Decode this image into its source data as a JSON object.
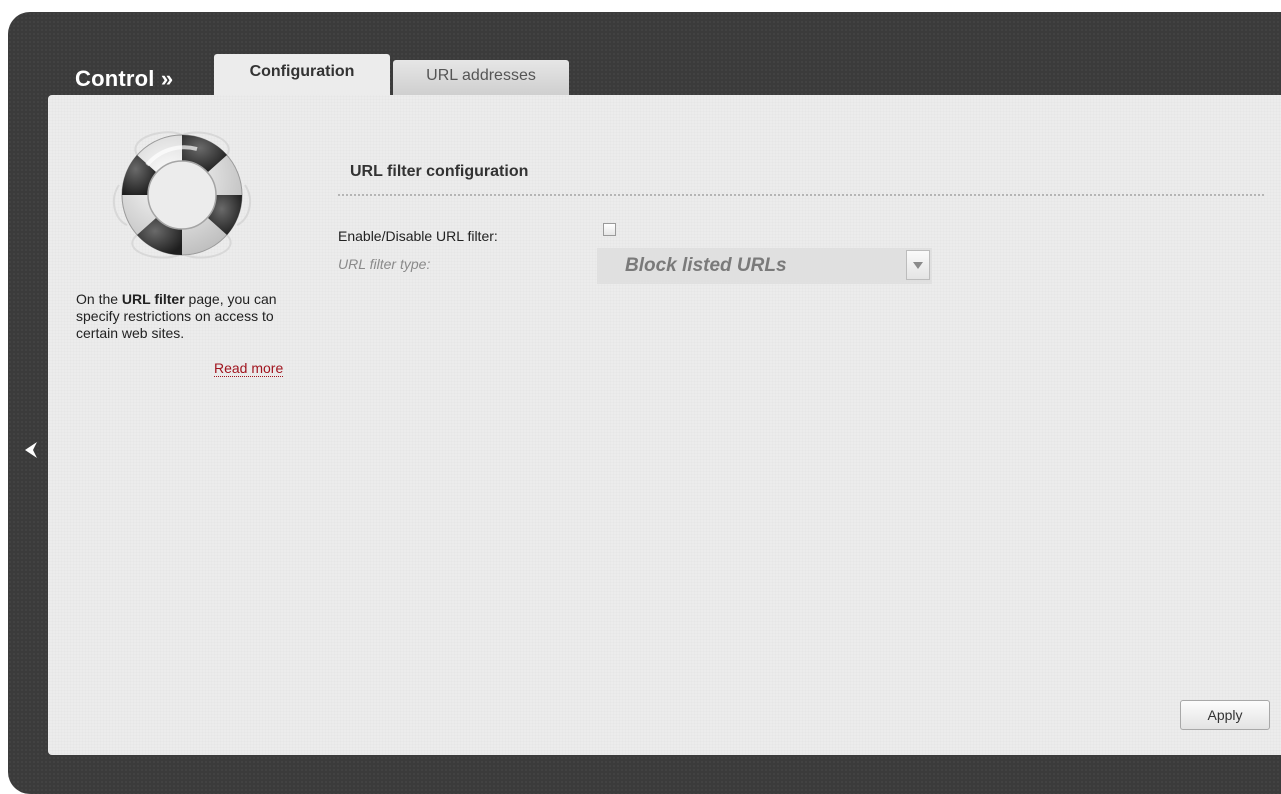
{
  "header": {
    "section_title": "Control »"
  },
  "tabs": [
    {
      "label": "Configuration",
      "active": true
    },
    {
      "label": "URL addresses",
      "active": false
    }
  ],
  "sidebar": {
    "icon": "lifebuoy-icon",
    "help_prefix": "On the ",
    "help_bold": "URL filter",
    "help_suffix": " page, you can specify restrictions on access to certain web sites.",
    "read_more": "Read more"
  },
  "form": {
    "group_title": "URL filter configuration",
    "enable_label": "Enable/Disable URL filter:",
    "enable_checked": false,
    "type_label": "URL filter type:",
    "type_value": "Block listed URLs"
  },
  "footer": {
    "apply_label": "Apply"
  },
  "nav": {
    "back_icon": "chevron-left-icon"
  },
  "colors": {
    "frame": "#3b3b3b",
    "panel": "#ececec",
    "link": "#a0141e"
  }
}
